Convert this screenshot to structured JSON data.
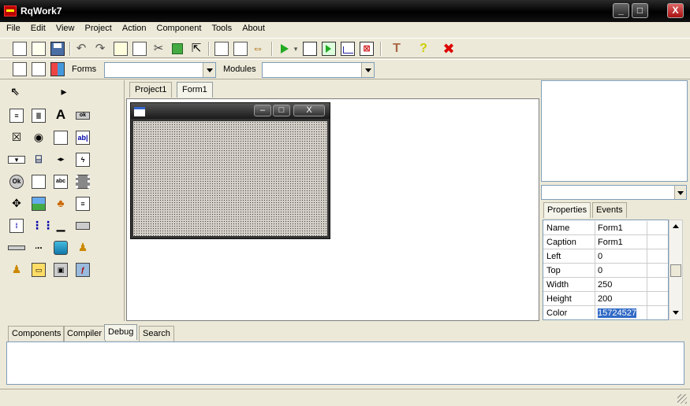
{
  "window": {
    "title": "RqWork7",
    "minimize_label": "_",
    "maximize_label": "□",
    "close_label": "X"
  },
  "menu": [
    "File",
    "Edit",
    "View",
    "Project",
    "Action",
    "Component",
    "Tools",
    "About"
  ],
  "toolbar": {
    "forms_label": "Forms",
    "forms_value": "",
    "modules_label": "Modules",
    "modules_value": ""
  },
  "palette_icons": [
    "pointer-icon",
    "play-right-icon",
    "main-menu-icon",
    "popup-menu-icon",
    "label-icon",
    "button-icon",
    "checkbox-icon",
    "radio-icon",
    "memo-icon",
    "edit-icon",
    "combobox-icon",
    "groupbox-icon",
    "updown-icon",
    "lightning-icon",
    "ok-button-icon",
    "panel-icon",
    "listview-icon",
    "film-icon",
    "splitter-icon",
    "image-icon",
    "paint-icon",
    "document-icon",
    "dots-icon",
    "grid-icon",
    "trackbar-icon",
    "progressbar-icon",
    "statusbar-icon",
    "gauge-icon",
    "cylinder-icon",
    "figure-icon",
    "figure2-icon",
    "open-folder-icon",
    "save-disk-icon",
    "font-icon"
  ],
  "designer": {
    "tabs": [
      "Project1",
      "Form1"
    ],
    "active_tab": "Form1",
    "form_minimize": "–",
    "form_maximize": "□",
    "form_close": "X"
  },
  "inspector": {
    "object_value": "",
    "tabs": [
      "Properties",
      "Events"
    ],
    "properties": [
      {
        "name": "Name",
        "value": "Form1"
      },
      {
        "name": "Caption",
        "value": "Form1"
      },
      {
        "name": "Left",
        "value": "0"
      },
      {
        "name": "Top",
        "value": "0"
      },
      {
        "name": "Width",
        "value": "250"
      },
      {
        "name": "Height",
        "value": "200"
      },
      {
        "name": "Color",
        "value": "15724527"
      }
    ],
    "selected_property": "Color"
  },
  "bottom_tabs": [
    "Components",
    "Compiler",
    "Debug",
    "Search"
  ],
  "bottom_active_tab": "Debug",
  "output_text": ""
}
